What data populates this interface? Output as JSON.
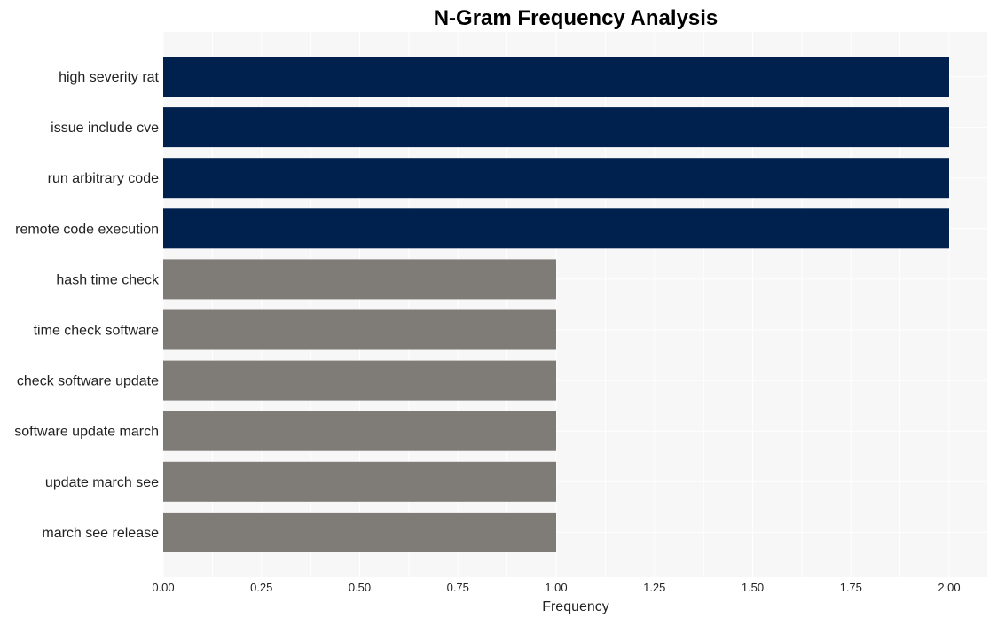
{
  "chart_data": {
    "type": "bar",
    "orientation": "horizontal",
    "title": "N-Gram Frequency Analysis",
    "xlabel": "Frequency",
    "ylabel": "",
    "xlim": [
      0,
      2.1
    ],
    "xticks": [
      0,
      0.25,
      0.5,
      0.75,
      1.0,
      1.25,
      1.5,
      1.75,
      2.0
    ],
    "xtick_labels": [
      "0.00",
      "0.25",
      "0.50",
      "0.75",
      "1.00",
      "1.25",
      "1.50",
      "1.75",
      "2.00"
    ],
    "grid": true,
    "categories": [
      "high severity rat",
      "issue include cve",
      "run arbitrary code",
      "remote code execution",
      "hash time check",
      "time check software",
      "check software update",
      "software update march",
      "update march see",
      "march see release"
    ],
    "values": [
      2,
      2,
      2,
      2,
      1,
      1,
      1,
      1,
      1,
      1
    ],
    "colors": {
      "highlight": "#00204e",
      "default": "#7f7c77",
      "background": "#f7f7f7",
      "grid": "#ffffff"
    }
  }
}
